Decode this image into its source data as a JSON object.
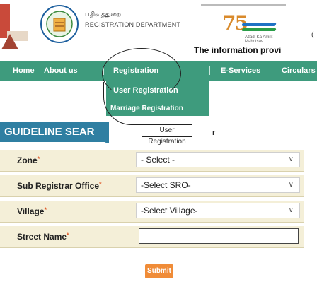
{
  "header": {
    "dept_tamil": "பதிவுத்துறை",
    "dept_name": "REGISTRATION DEPARTMENT",
    "azadi_numeral": "75",
    "azadi_caption": "Azadi Ka Amrit Mahotsav",
    "stray_char": "(",
    "marquee": "The information provi"
  },
  "nav": {
    "items": [
      {
        "label": "Home"
      },
      {
        "label": "About us"
      },
      {
        "label": "Registration"
      },
      {
        "label": "E-Services"
      },
      {
        "label": "Circulars"
      }
    ]
  },
  "dropdown": {
    "item1": "User Registration",
    "item2": "Marriage Registration"
  },
  "tooltip": "User Registration",
  "page_title": "GUIDELINE SEAR",
  "title_tail": "r",
  "form": {
    "zone": {
      "label": "Zone",
      "value": "- Select -"
    },
    "sro": {
      "label": "Sub Registrar Office",
      "value": "-Select SRO-"
    },
    "village": {
      "label": "Village",
      "value": "-Select Village-"
    },
    "street": {
      "label": "Street Name",
      "value": ""
    },
    "required_mark": "*",
    "submit": "Submit"
  },
  "colors": {
    "nav_green": "#3e9b7d",
    "title_blue": "#2f7fa2",
    "form_row": "#f4efd8",
    "submit": "#f08c38"
  }
}
